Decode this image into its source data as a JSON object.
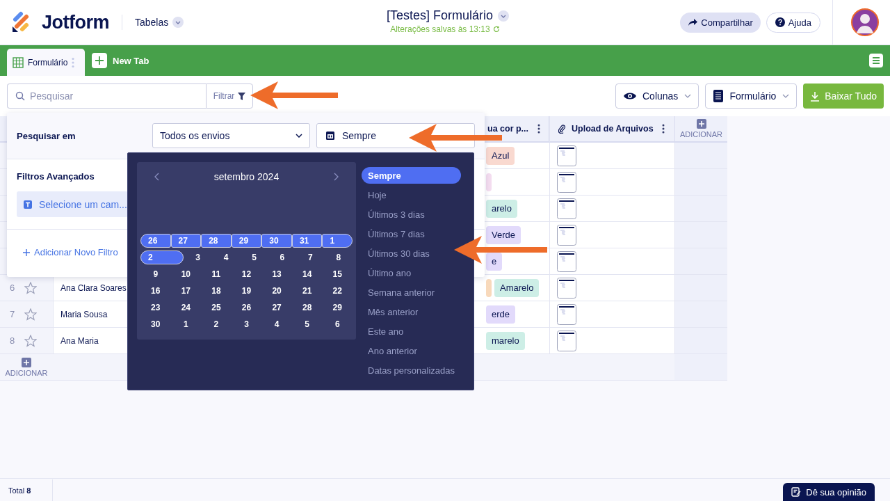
{
  "header": {
    "logo": "Jotform",
    "nav": "Tabelas",
    "title": "[Testes] Formulário",
    "saved": "Alterações salvas às 13:13",
    "buttons": [
      {
        "kind": "share",
        "label": "Compartilhar"
      },
      {
        "kind": "help",
        "label": "Ajuda"
      }
    ]
  },
  "tabs": [
    {
      "label": "Formulário",
      "selected": true
    }
  ],
  "new_tab": "New Tab",
  "toolbar": {
    "search": {
      "placeholder": "Pesquisar"
    },
    "filter": "Filtrar",
    "buttons": [
      {
        "kind": "columns",
        "label": "Colunas"
      },
      {
        "kind": "form",
        "label": "Formulário"
      },
      {
        "kind": "download",
        "label": "Baixar Tudo"
      }
    ]
  },
  "table": {
    "columns": [
      {
        "kind": "text",
        "label": "ua cor p..."
      },
      {
        "kind": "file",
        "label": "Upload de Arquivos"
      }
    ],
    "add": "ADICIONAR",
    "add_row": "ADICIONAR",
    "rows": [
      {
        "tags": [
          {
            "text": "Azul",
            "color": "#f9d9d0"
          }
        ]
      },
      {
        "tags": [
          {
            "color": "#f3dcef"
          }
        ]
      },
      {
        "tags": [
          {
            "text": "arelo",
            "color": "#cdeee6"
          }
        ]
      },
      {
        "tags": [
          {
            "text": "Verde",
            "color": "#e2dafb"
          }
        ]
      },
      {
        "tags": [
          {
            "text": "e",
            "color": "#e2dafb"
          }
        ]
      },
      {
        "number": "6",
        "starred": false,
        "name": "Ana Clara Soares",
        "tags": [
          {
            "color": "#f8d9bb"
          },
          {
            "text": "Amarelo",
            "color": "#cdeee6"
          }
        ]
      },
      {
        "number": "7",
        "starred": false,
        "name": "Maria Sousa",
        "tags": [
          {
            "text": "erde",
            "color": "#e2dafb"
          }
        ]
      },
      {
        "number": "8",
        "starred": false,
        "name": "Ana Maria",
        "tags": [
          {
            "text": "marelo",
            "color": "#cdeee6"
          }
        ]
      }
    ]
  },
  "footer": {
    "total_label": "Total",
    "total": "8",
    "feedback": "Dê sua opinião"
  },
  "filter_panel": {
    "search_in_label": "Pesquisar em",
    "scope": "Todos os envios",
    "date": "Sempre",
    "advanced_label": "Filtros Avançados",
    "field_placeholder": "Selecione um cam...",
    "add_filter": "Adicionar Novo Filtro"
  },
  "calendar": {
    "month": "setembro 2024",
    "weeks": [
      {
        "days": [
          {
            "day": "26",
            "selected": true
          },
          {
            "day": "27",
            "selected": true
          },
          {
            "day": "28",
            "selected": true
          },
          {
            "day": "29",
            "selected": true
          },
          {
            "day": "30",
            "selected": true
          },
          {
            "day": "31",
            "selected": true
          },
          {
            "day": "1",
            "selected": true
          }
        ]
      },
      {
        "days": [
          {
            "day": "2",
            "selected": true
          },
          {
            "day": "3",
            "selected": false
          },
          {
            "day": "4",
            "selected": false
          },
          {
            "day": "5",
            "selected": false
          },
          {
            "day": "6",
            "selected": false
          },
          {
            "day": "7",
            "selected": false
          },
          {
            "day": "8",
            "selected": false
          }
        ]
      },
      {
        "days": [
          {
            "day": "9",
            "selected": false
          },
          {
            "day": "10",
            "selected": false
          },
          {
            "day": "11",
            "selected": false
          },
          {
            "day": "12",
            "selected": false
          },
          {
            "day": "13",
            "selected": false
          },
          {
            "day": "14",
            "selected": false
          },
          {
            "day": "15",
            "selected": false
          }
        ]
      },
      {
        "days": [
          {
            "day": "16",
            "selected": false
          },
          {
            "day": "17",
            "selected": false
          },
          {
            "day": "18",
            "selected": false
          },
          {
            "day": "19",
            "selected": false
          },
          {
            "day": "20",
            "selected": false
          },
          {
            "day": "21",
            "selected": false
          },
          {
            "day": "22",
            "selected": false
          }
        ]
      },
      {
        "days": [
          {
            "day": "23",
            "selected": false
          },
          {
            "day": "24",
            "selected": false
          },
          {
            "day": "25",
            "selected": false
          },
          {
            "day": "26",
            "selected": false
          },
          {
            "day": "27",
            "selected": false
          },
          {
            "day": "28",
            "selected": false
          },
          {
            "day": "29",
            "selected": false
          }
        ]
      },
      {
        "days": [
          {
            "day": "30",
            "selected": false
          },
          {
            "day": "1",
            "selected": false
          },
          {
            "day": "2",
            "selected": false
          },
          {
            "day": "3",
            "selected": false
          },
          {
            "day": "4",
            "selected": false
          },
          {
            "day": "5",
            "selected": false
          },
          {
            "day": "6",
            "selected": false
          }
        ]
      }
    ],
    "presets": [
      {
        "label": "Sempre",
        "selected": true
      },
      {
        "label": "Hoje",
        "selected": false
      },
      {
        "label": "Últimos 3 dias",
        "selected": false
      },
      {
        "label": "Últimos 7 dias",
        "selected": false
      },
      {
        "label": "Últimos 30 dias",
        "selected": false
      },
      {
        "label": "Último ano",
        "selected": false
      },
      {
        "label": "Semana anterior",
        "selected": false
      },
      {
        "label": "Mês anterior",
        "selected": false
      },
      {
        "label": "Este ano",
        "selected": false
      },
      {
        "label": "Ano anterior",
        "selected": false
      },
      {
        "label": "Datas personalizadas",
        "selected": false
      }
    ]
  },
  "annotations": [
    {
      "kind": "arrow"
    },
    {
      "kind": "arrow"
    },
    {
      "kind": "arrow"
    }
  ]
}
